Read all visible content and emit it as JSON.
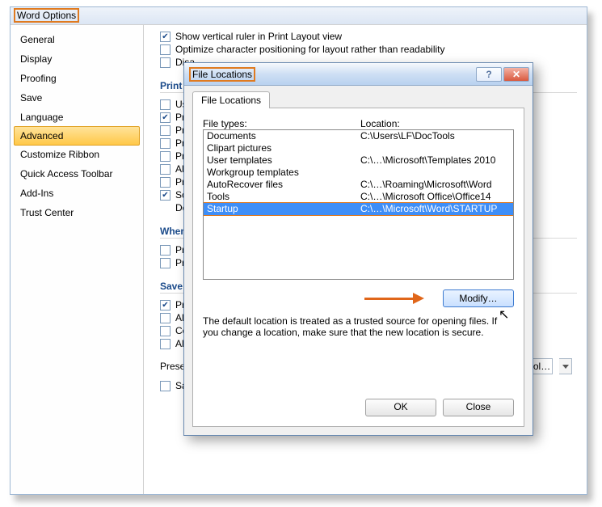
{
  "wordOptions": {
    "title": "Word Options",
    "sidebar": [
      "General",
      "Display",
      "Proofing",
      "Save",
      "Language",
      "Advanced",
      "Customize Ribbon",
      "Quick Access Toolbar",
      "Add-Ins",
      "Trust Center"
    ],
    "selectedSidebarIndex": 5,
    "topOpts": [
      {
        "checked": true,
        "label": "Show vertical ruler in Print Layout view"
      },
      {
        "checked": false,
        "label": "Optimize character positioning for layout rather than readability"
      },
      {
        "checked": false,
        "label": "Disa"
      }
    ],
    "print": {
      "heading": "Print",
      "opts": [
        {
          "checked": false,
          "label": "Use"
        },
        {
          "checked": true,
          "label": "Print"
        },
        {
          "checked": false,
          "label": "Print"
        },
        {
          "checked": false,
          "label": "Print"
        },
        {
          "checked": false,
          "label": "Print"
        },
        {
          "checked": false,
          "label": "Allow"
        },
        {
          "checked": false,
          "label": "Print"
        },
        {
          "checked": true,
          "label": "Scale"
        }
      ],
      "defaultLabel": "Default"
    },
    "whenPrinting": {
      "heading": "When pri",
      "opts": [
        {
          "checked": false,
          "label": "Print"
        },
        {
          "checked": false,
          "label": "Print"
        }
      ]
    },
    "save": {
      "heading": "Save",
      "opts": [
        {
          "checked": true,
          "label": "Pron"
        },
        {
          "checked": false,
          "label": "Alwa"
        },
        {
          "checked": false,
          "label": "Cop"
        },
        {
          "checked": false,
          "label": "Allow"
        }
      ]
    },
    "preserve": {
      "label": "Preserve fidelity when sharing this document:",
      "docName": "How to install an add-in from DocTool…"
    },
    "bottomOpt": {
      "checked": false,
      "label": "Save form data as delimited text file"
    }
  },
  "dialog": {
    "title": "File Locations",
    "tab": "File Locations",
    "headers": {
      "types": "File types:",
      "location": "Location:"
    },
    "rows": [
      {
        "type": "Documents",
        "loc": "C:\\Users\\LF\\DocTools"
      },
      {
        "type": "Clipart pictures",
        "loc": ""
      },
      {
        "type": "User templates",
        "loc": "C:\\…\\Microsoft\\Templates 2010"
      },
      {
        "type": "Workgroup templates",
        "loc": ""
      },
      {
        "type": "AutoRecover files",
        "loc": "C:\\…\\Roaming\\Microsoft\\Word"
      },
      {
        "type": "Tools",
        "loc": "C:\\…\\Microsoft Office\\Office14"
      },
      {
        "type": "Startup",
        "loc": "C:\\…\\Microsoft\\Word\\STARTUP"
      }
    ],
    "selectedRowIndex": 6,
    "modify": "Modify…",
    "note": "The default location is treated as a trusted source for opening files. If you change a location, make sure that the new location is secure.",
    "ok": "OK",
    "close": "Close"
  }
}
